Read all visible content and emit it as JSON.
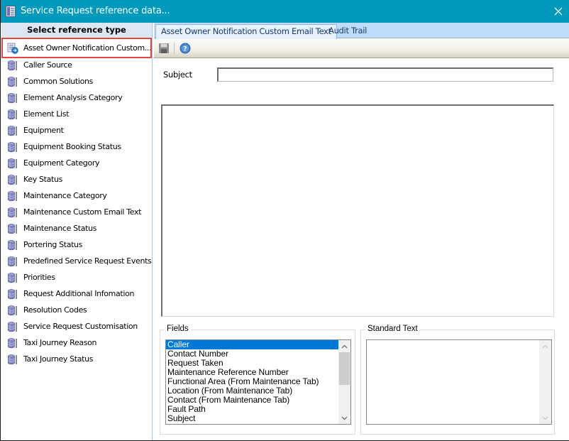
{
  "window": {
    "title": "Service Request reference data...",
    "close_label": "Close"
  },
  "sidebar": {
    "header": "Select reference type",
    "items": [
      {
        "label": "Asset Owner Notification Custom...",
        "icon": "email-settings-icon",
        "selected": true
      },
      {
        "label": "Caller Source",
        "icon": "database-icon"
      },
      {
        "label": "Common Solutions",
        "icon": "database-icon"
      },
      {
        "label": "Element Analysis Category",
        "icon": "database-icon"
      },
      {
        "label": "Element List",
        "icon": "database-icon"
      },
      {
        "label": "Equipment",
        "icon": "database-icon"
      },
      {
        "label": "Equipment Booking Status",
        "icon": "database-icon"
      },
      {
        "label": "Equipment Category",
        "icon": "database-icon"
      },
      {
        "label": "Key Status",
        "icon": "database-icon"
      },
      {
        "label": "Maintenance Category",
        "icon": "database-icon"
      },
      {
        "label": "Maintenance Custom Email Text",
        "icon": "database-icon"
      },
      {
        "label": "Maintenance Status",
        "icon": "database-icon"
      },
      {
        "label": "Portering Status",
        "icon": "database-icon"
      },
      {
        "label": "Predefined Service Request Events",
        "icon": "database-icon"
      },
      {
        "label": "Priorities",
        "icon": "database-icon"
      },
      {
        "label": "Request Additional Infomation",
        "icon": "database-icon"
      },
      {
        "label": "Resolution Codes",
        "icon": "database-icon"
      },
      {
        "label": "Service Request Customisation",
        "icon": "database-icon"
      },
      {
        "label": "Taxi Journey Reason",
        "icon": "database-icon"
      },
      {
        "label": "Taxi Journey Status",
        "icon": "database-icon"
      }
    ]
  },
  "main": {
    "tabs": [
      {
        "label": "Asset Owner Notification Custom Email Text",
        "active": true
      },
      {
        "label": "Audit Trail",
        "active": false
      }
    ],
    "toolbar": {
      "save_icon": "save-icon",
      "help_icon": "help-icon"
    },
    "subject": {
      "label": "Subject",
      "value": ""
    },
    "body": {
      "value": ""
    },
    "fields": {
      "legend": "Fields",
      "items": [
        {
          "label": "Caller",
          "selected": true
        },
        {
          "label": "Contact Number"
        },
        {
          "label": "Request Taken"
        },
        {
          "label": "Maintenance Reference Number"
        },
        {
          "label": "Functional Area (From Maintenance Tab)"
        },
        {
          "label": "Location (From Maintenance Tab)"
        },
        {
          "label": "Contact (From Maintenance Tab)"
        },
        {
          "label": "Fault Path"
        },
        {
          "label": "Subject"
        }
      ]
    },
    "standard_text": {
      "legend": "Standard Text",
      "items": []
    }
  },
  "colors": {
    "titlebar": "#0199bc",
    "tabbar": "#c0dcfd",
    "selection": "#0078d7",
    "highlight_outline": "#e8443f"
  }
}
